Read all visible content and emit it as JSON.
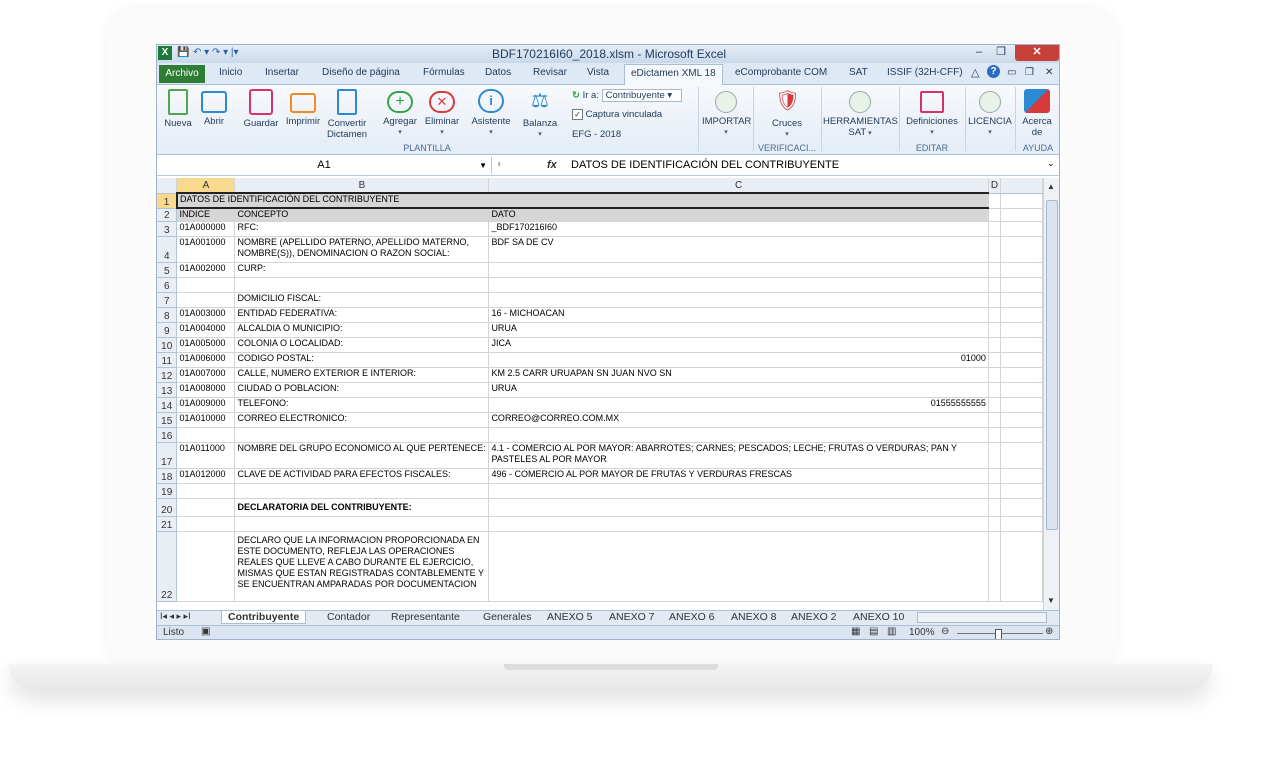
{
  "window": {
    "title": "BDF170216I60_2018.xlsm - Microsoft Excel",
    "qat": "↶ ▾ ↷ ▾ |▾",
    "min": "–",
    "restore": "❐",
    "close": "✕"
  },
  "tabs": [
    {
      "label": "Archivo"
    },
    {
      "label": "Inicio"
    },
    {
      "label": "Insertar"
    },
    {
      "label": "Diseño de página"
    },
    {
      "label": "Fórmulas"
    },
    {
      "label": "Datos"
    },
    {
      "label": "Revisar"
    },
    {
      "label": "Vista"
    },
    {
      "label": "eDictamen XML 18"
    },
    {
      "label": "eComprobante COM"
    },
    {
      "label": "SAT"
    },
    {
      "label": "ISSIF (32H-CFF)"
    }
  ],
  "ribbon": {
    "nueva": "Nueva",
    "abrir": "Abrir",
    "guardar": "Guardar",
    "imprimir": "Imprimir",
    "convertir": "Convertir",
    "dictamen": "Dictamen",
    "agregar": "Agregar",
    "eliminar": "Eliminar",
    "asistente": "Asistente",
    "balanza": "Balanza",
    "ira_label": "Ir a:",
    "ira_value": "Contribuyente",
    "captura": "Captura vinculada",
    "efg": "EFG - 2018",
    "importar": "IMPORTAR",
    "cruces": "Cruces",
    "herramientas": "HERRAMIENTAS",
    "sat": "SAT",
    "definiciones": "Definiciones",
    "licencia": "LICENCIA",
    "acerca": "Acerca",
    "de": "de",
    "group_plantilla": "PLANTILLA",
    "group_verificacion": "VERIFICACI...",
    "group_editar": "EDITAR",
    "group_ayuda": "AYUDA"
  },
  "formula_bar": {
    "cell": "A1",
    "fx": "fx",
    "content": "DATOS DE IDENTIFICACIÓN DEL CONTRIBUYENTE"
  },
  "columns": [
    "A",
    "B",
    "C",
    "D"
  ],
  "rows": [
    {
      "n": "1",
      "a": "DATOS DE IDENTIFICACIÓN DEL CONTRIBUYENTE",
      "b": "",
      "c": ""
    },
    {
      "n": "2",
      "a": "INDICE",
      "b": "CONCEPTO",
      "c": "DATO"
    },
    {
      "n": "3",
      "a": "01A000000",
      "b": "RFC:",
      "c": "_BDF170216I60"
    },
    {
      "n": "4",
      "a": "01A001000",
      "b": "NOMBRE (APELLIDO PATERNO, APELLIDO MATERNO, NOMBRE(S)), DENOMINACION O RAZON SOCIAL:",
      "c": "BDF SA DE CV"
    },
    {
      "n": "5",
      "a": "01A002000",
      "b": "CURP:",
      "c": ""
    },
    {
      "n": "6",
      "a": "",
      "b": "",
      "c": ""
    },
    {
      "n": "7",
      "a": "",
      "b": "DOMICILIO FISCAL:",
      "c": ""
    },
    {
      "n": "8",
      "a": "01A003000",
      "b": "ENTIDAD FEDERATIVA:",
      "c": "16 - MICHOACAN"
    },
    {
      "n": "9",
      "a": "01A004000",
      "b": "ALCALDIA O MUNICIPIO:",
      "c": "URUA"
    },
    {
      "n": "10",
      "a": "01A005000",
      "b": "COLONIA O LOCALIDAD:",
      "c": "JICA"
    },
    {
      "n": "11",
      "a": "01A006000",
      "b": "CODIGO POSTAL:",
      "c": "01000"
    },
    {
      "n": "12",
      "a": "01A007000",
      "b": "CALLE, NUMERO EXTERIOR E INTERIOR:",
      "c": "KM 2.5 CARR URUAPAN SN JUAN NVO SN"
    },
    {
      "n": "13",
      "a": "01A008000",
      "b": "CIUDAD O POBLACION:",
      "c": "URUA"
    },
    {
      "n": "14",
      "a": "01A009000",
      "b": "TELEFONO:",
      "c": "01555555555"
    },
    {
      "n": "15",
      "a": "01A010000",
      "b": "CORREO ELECTRONICO:",
      "c": "CORREO@CORREO.COM.MX"
    },
    {
      "n": "16",
      "a": "",
      "b": "",
      "c": ""
    },
    {
      "n": "17",
      "a": "01A011000",
      "b": "NOMBRE DEL GRUPO ECONOMICO AL QUE PERTENECE:",
      "c": "4.1 - COMERCIO AL POR MAYOR: ABARROTES; CARNES; PESCADOS; LECHE; FRUTAS O VERDURAS; PAN Y PASTELES AL POR MAYOR"
    },
    {
      "n": "18",
      "a": "01A012000",
      "b": "CLAVE DE ACTIVIDAD PARA EFECTOS FISCALES:",
      "c": "496 - COMERCIO AL POR MAYOR DE FRUTAS Y VERDURAS FRESCAS"
    },
    {
      "n": "19",
      "a": "",
      "b": "",
      "c": ""
    },
    {
      "n": "20",
      "a": "",
      "b": "DECLARATORIA DEL CONTRIBUYENTE:",
      "c": ""
    },
    {
      "n": "21",
      "a": "",
      "b": "",
      "c": ""
    },
    {
      "n": "22",
      "a": "",
      "b": "DECLARO QUE LA INFORMACION PROPORCIONADA EN ESTE DOCUMENTO, REFLEJA LAS OPERACIONES REALES QUE LLEVE A CABO DURANTE EL EJERCICIO, MISMAS QUE ESTAN REGISTRADAS CONTABLEMENTE Y SE ENCUENTRAN AMPARADAS POR DOCUMENTACION",
      "c": ""
    }
  ],
  "sheet_tabs": [
    "Contribuyente",
    "Contador",
    "Representante",
    "Generales",
    "ANEXO 5",
    "ANEXO 7",
    "ANEXO 6",
    "ANEXO 8",
    "ANEXO 2",
    "ANEXO 10"
  ],
  "status": {
    "ready": "Listo",
    "zoom": "100%"
  }
}
